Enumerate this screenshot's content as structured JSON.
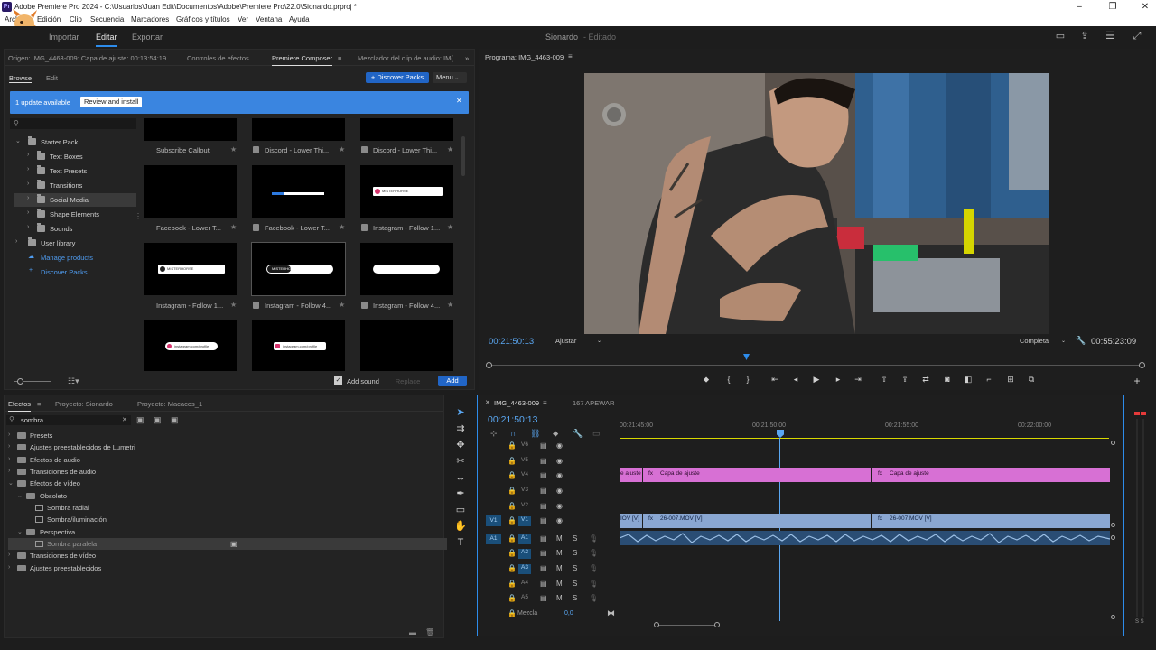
{
  "window": {
    "title": "Adobe Premiere Pro 2024 - C:\\Usuarios\\Juan Edit\\Documentos\\Adobe\\Premiere Pro\\22.0\\Sionardo.prproj *",
    "app_icon": "Pr"
  },
  "menu": [
    "Archivo",
    "Edición",
    "Clip",
    "Secuencia",
    "Marcadores",
    "Gráficos y títulos",
    "Ver",
    "Ventana",
    "Ayuda"
  ],
  "workspace": {
    "tabs": [
      "Importar",
      "Editar",
      "Exportar"
    ],
    "active": "Editar",
    "project": "Sionardo",
    "status": "- Editado"
  },
  "source_panel": {
    "tabs": [
      "Origen: IMG_4463-009: Capa de ajuste: 00:13:54:19",
      "Controles de efectos",
      "Premiere Composer",
      "Mezclador del clip de audio: IM("
    ],
    "active": "Premiere Composer"
  },
  "composer": {
    "subtabs": [
      "Browse",
      "Edit"
    ],
    "discover_label": "Discover Packs",
    "menu_label": "Menu",
    "update_text": "1 update available",
    "update_button": "Review and install",
    "tree": [
      {
        "label": "Starter Pack",
        "level": 0,
        "open": true
      },
      {
        "label": "Text Boxes",
        "level": 1
      },
      {
        "label": "Text Presets",
        "level": 1
      },
      {
        "label": "Transitions",
        "level": 1
      },
      {
        "label": "Social Media",
        "level": 1,
        "selected": true
      },
      {
        "label": "Shape Elements",
        "level": 1
      },
      {
        "label": "Sounds",
        "level": 1
      },
      {
        "label": "User library",
        "level": 0
      }
    ],
    "links": [
      {
        "label": "Manage products"
      },
      {
        "label": "Discover Packs"
      }
    ],
    "tiles": [
      {
        "label": "Subscribe Callout"
      },
      {
        "label": "Discord - Lower Thi..."
      },
      {
        "label": "Discord - Lower Thi..."
      },
      {
        "label": "Facebook - Lower T..."
      },
      {
        "label": "Facebook - Lower T..."
      },
      {
        "label": "Instagram - Follow 1..."
      },
      {
        "label": "Instagram - Follow 1..."
      },
      {
        "label": "Instagram - Follow 4..."
      },
      {
        "label": "Instagram - Follow 4..."
      },
      {
        "label": ""
      },
      {
        "label": ""
      },
      {
        "label": ""
      }
    ],
    "thumb_texts": [
      "MISTERHORSE",
      "MISTERHORSE",
      "MISTERHORSE",
      "instagram.com/profile",
      "instagram.com/profile"
    ],
    "add_sound": "Add sound",
    "replace": "Replace",
    "add": "Add"
  },
  "program": {
    "title": "Programa: IMG_4463-009",
    "timecode": "00:21:50:13",
    "fit": "Ajustar",
    "quality": "Completa",
    "duration": "00:55:23:09"
  },
  "effects": {
    "tabs": [
      "Efectos",
      "Proyecto: Sionardo",
      "Proyecto: Macacos_1"
    ],
    "search": "sombra",
    "rows": [
      {
        "label": "Presets",
        "level": 0,
        "type": "folder"
      },
      {
        "label": "Ajustes preestablecidos de Lumetri",
        "level": 0,
        "type": "folder"
      },
      {
        "label": "Efectos de audio",
        "level": 0,
        "type": "folder"
      },
      {
        "label": "Transiciones de audio",
        "level": 0,
        "type": "folder"
      },
      {
        "label": "Efectos de vídeo",
        "level": 0,
        "type": "folder",
        "open": true
      },
      {
        "label": "Obsoleto",
        "level": 1,
        "type": "folder",
        "open": true
      },
      {
        "label": "Sombra radial",
        "level": 2,
        "type": "effect"
      },
      {
        "label": "Sombra/iluminación",
        "level": 2,
        "type": "effect"
      },
      {
        "label": "Perspectiva",
        "level": 1,
        "type": "folder",
        "open": true
      },
      {
        "label": "Sombra paralela",
        "level": 2,
        "type": "effect",
        "selected": true
      },
      {
        "label": "Transiciones de vídeo",
        "level": 0,
        "type": "folder"
      },
      {
        "label": "Ajustes preestablecidos",
        "level": 0,
        "type": "folder"
      }
    ]
  },
  "timeline": {
    "tabs": [
      "IMG_4463-009",
      "167 APEWAR"
    ],
    "timecode": "00:21:50:13",
    "ruler": [
      "00:21:45:00",
      "00:21:50:00",
      "00:21:55:00",
      "00:22:00:00"
    ],
    "video_tracks": [
      "V6",
      "V5",
      "V4",
      "V3",
      "V2",
      "V1"
    ],
    "audio_tracks": [
      "A1",
      "A2",
      "A3",
      "A4",
      "A5"
    ],
    "source_v": "V1",
    "source_a": "A1",
    "mix_label": "Mezcla",
    "mix_value": "0,0",
    "clips": {
      "v4": [
        "e ajuste",
        "Capa de ajuste",
        "Capa de ajuste"
      ],
      "v1": [
        "IOV [V]",
        "26-007.MOV [V]",
        "26-007.MOV [V]"
      ]
    },
    "meter_label": "S S"
  },
  "colors": {
    "accent": "#2d8ceb",
    "adjustment_clip": "#d770d4",
    "video_clip": "#8aa7d2"
  }
}
